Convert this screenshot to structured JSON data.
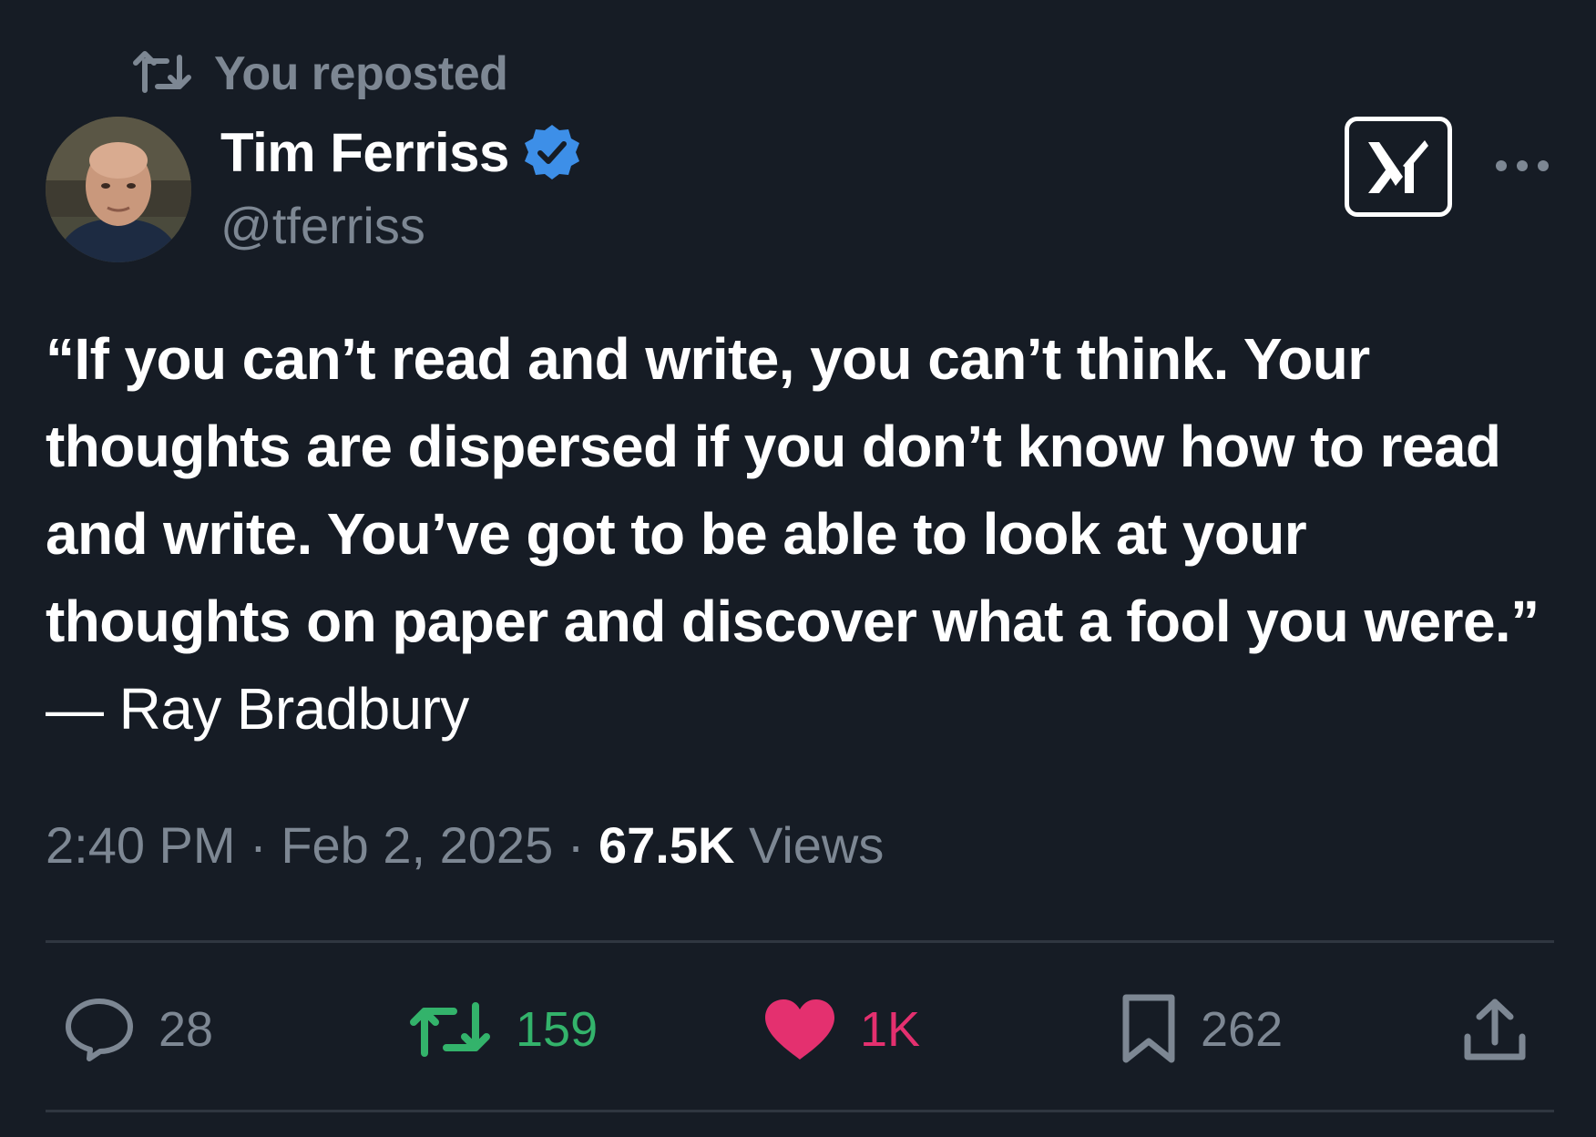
{
  "repost": {
    "icon": "repost-icon",
    "label": "You reposted"
  },
  "author": {
    "name": "Tim Ferriss",
    "handle": "@tferriss",
    "verified": true,
    "verified_color": "#3d8fe8"
  },
  "header_actions": {
    "grok_icon": "grok-icon",
    "more_icon": "more-icon"
  },
  "tweet": {
    "quote": "“If you can’t read and write, you can’t think. Your thoughts are dispersed if you don’t know how to read and write. You’ve got to be able to look at your thoughts on paper and discover what a fool you were.”",
    "attribution": " — Ray Bradbury"
  },
  "meta": {
    "time": "2:40 PM",
    "separator": " · ",
    "date": "Feb 2, 2025",
    "views_count": "67.5K",
    "views_label": " Views"
  },
  "actions": {
    "replies": "28",
    "reposts": "159",
    "likes": "1K",
    "bookmarks": "262",
    "repost_color": "#33b36b",
    "like_color": "#e4306f"
  }
}
